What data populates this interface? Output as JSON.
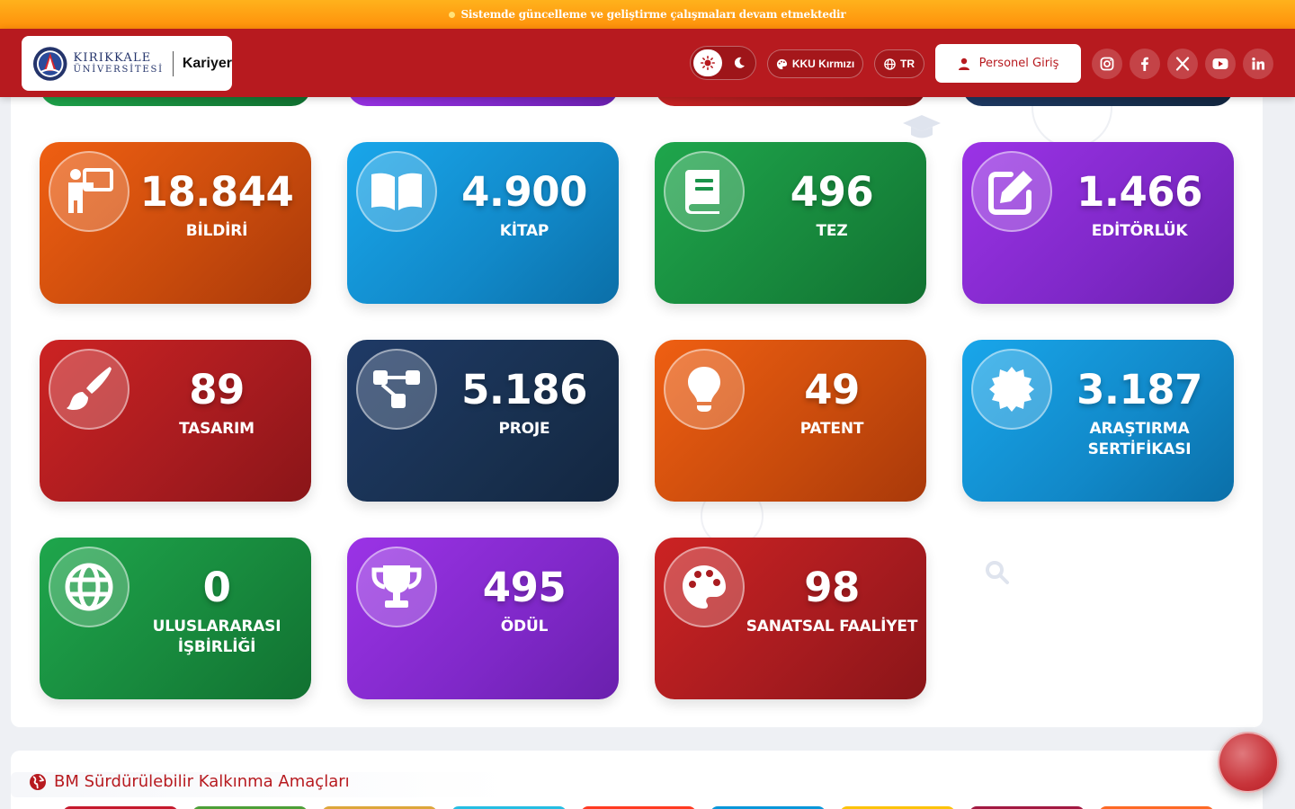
{
  "announcement": {
    "text": "Sistemde güncelleme ve geliştirme çalışmaları devam etmektedir"
  },
  "header": {
    "logo": {
      "line1": "KIRIKKALE",
      "line2": "ÜNİVERSİTESİ",
      "section": "Kariyer"
    },
    "theme_color_label": "KKU Kırmızı",
    "language_label": "TR",
    "login_label": "Personel Giriş",
    "social": [
      "instagram-icon",
      "facebook-icon",
      "x-icon",
      "youtube-icon",
      "linkedin-icon"
    ]
  },
  "stats": [
    {
      "value": "18.844",
      "label": "BİLDİRİ",
      "icon": "presenter-icon",
      "color": "orange"
    },
    {
      "value": "4.900",
      "label": "KİTAP",
      "icon": "book-open-icon",
      "color": "blue"
    },
    {
      "value": "496",
      "label": "TEZ",
      "icon": "book-icon",
      "color": "green"
    },
    {
      "value": "1.466",
      "label": "EDİTÖRLÜK",
      "icon": "edit-icon",
      "color": "purple"
    },
    {
      "value": "89",
      "label": "TASARIM",
      "icon": "brush-icon",
      "color": "red"
    },
    {
      "value": "5.186",
      "label": "PROJE",
      "icon": "diagram-icon",
      "color": "navy"
    },
    {
      "value": "49",
      "label": "PATENT",
      "icon": "lightbulb-icon",
      "color": "orange"
    },
    {
      "value": "3.187",
      "label": "ARAŞTIRMA SERTİFİKASI",
      "icon": "certificate-icon",
      "color": "blue"
    },
    {
      "value": "0",
      "label": "ULUSLARARASI İŞBİRLİĞİ",
      "icon": "globe-icon",
      "color": "green"
    },
    {
      "value": "495",
      "label": "ÖDÜL",
      "icon": "trophy-icon",
      "color": "purple"
    },
    {
      "value": "98",
      "label": "SANATSAL FAALİYET",
      "icon": "palette-icon",
      "color": "red"
    }
  ],
  "sdg": {
    "title": "BM Sürdürülebilir Kalkınma Amaçları"
  },
  "colors": {
    "brand_red": "#b71a1f",
    "announcement_orange": "#ff9a10"
  }
}
